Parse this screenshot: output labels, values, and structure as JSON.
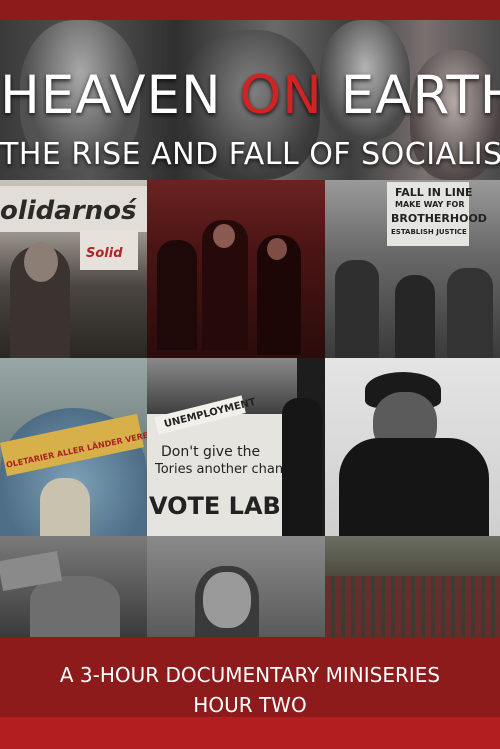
{
  "title": {
    "word1": "HEAVEN",
    "word2": "ON",
    "word3": "EARTH",
    "subtitle": "THE RISE AND FALL OF SOCIALISM"
  },
  "images": {
    "solidarnosc_banner": "olidarnoś",
    "solidarnosc_sign": "Solid",
    "brotherhood_sign": [
      "FALL IN LINE",
      "MAKE WAY FOR",
      "BROTHERHOOD",
      "ESTABLISH JUSTICE"
    ],
    "proletarier_banner": "OLETARIER ALLER LÄNDER VEREINIGT EUCH!",
    "unemployment_sign": "UNEMPLOYMENT",
    "tories_text_line1": "Don't give the",
    "tories_text_line2": "Tories another chance",
    "vote_labour": "VOTE LABOU"
  },
  "footer": {
    "line1": "A 3-HOUR DOCUMENTARY MINISERIES",
    "line2": "HOUR TWO"
  },
  "colors": {
    "accent_red": "#d32223",
    "band_red": "#b31f20",
    "footer_red": "#961c1c"
  }
}
